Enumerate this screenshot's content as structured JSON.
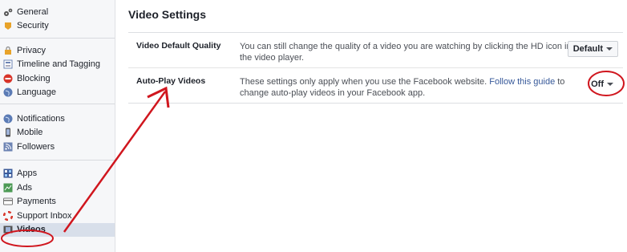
{
  "sidebar": {
    "groups": [
      {
        "items": [
          {
            "label": "General",
            "icon": "gear-icon"
          },
          {
            "label": "Security",
            "icon": "badge-icon"
          }
        ]
      },
      {
        "items": [
          {
            "label": "Privacy",
            "icon": "lock-icon"
          },
          {
            "label": "Timeline and Tagging",
            "icon": "timeline-icon"
          },
          {
            "label": "Blocking",
            "icon": "block-icon"
          },
          {
            "label": "Language",
            "icon": "globe-icon"
          }
        ]
      },
      {
        "items": [
          {
            "label": "Notifications",
            "icon": "globe-icon"
          },
          {
            "label": "Mobile",
            "icon": "mobile-icon"
          },
          {
            "label": "Followers",
            "icon": "rss-icon"
          }
        ]
      },
      {
        "items": [
          {
            "label": "Apps",
            "icon": "apps-icon"
          },
          {
            "label": "Ads",
            "icon": "ads-icon"
          },
          {
            "label": "Payments",
            "icon": "card-icon"
          },
          {
            "label": "Support Inbox",
            "icon": "lifebuoy-icon"
          },
          {
            "label": "Videos",
            "icon": "film-icon"
          }
        ]
      }
    ]
  },
  "main": {
    "title": "Video Settings",
    "rows": [
      {
        "label": "Video Default Quality",
        "desc": "You can still change the quality of a video you are watching by clicking the HD icon in the video player.",
        "value": "Default"
      },
      {
        "label": "Auto-Play Videos",
        "desc_before": "These settings only apply when you use the Facebook website. ",
        "link": "Follow this guide",
        "desc_after": " to change auto-play videos in your Facebook app.",
        "value": "Off"
      }
    ]
  },
  "colors": {
    "annotation": "#d0161e",
    "link": "#365899",
    "active_bg": "#d8dfea"
  }
}
